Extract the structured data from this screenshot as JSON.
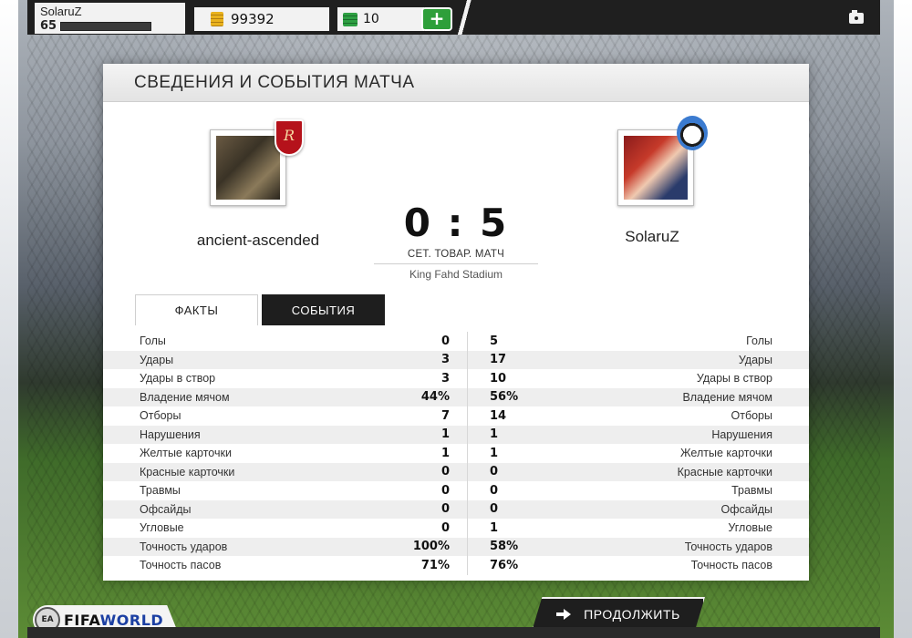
{
  "topbar": {
    "username": "SolaruZ",
    "level": "65",
    "coins": "99392",
    "points": "10",
    "plus_label": "+"
  },
  "panel": {
    "title": "СВЕДЕНИЯ И СОБЫТИЯ МАТЧА"
  },
  "match": {
    "home_team": "ancient-ascended",
    "away_team": "SolaruZ",
    "score": "0 : 5",
    "match_type": "СЕТ. ТОВАР. МАТЧ",
    "stadium": "King Fahd Stadium"
  },
  "tabs": [
    {
      "label": "ФАКТЫ",
      "active": true
    },
    {
      "label": "СОБЫТИЯ",
      "active": false
    }
  ],
  "stats": [
    {
      "label": "Голы",
      "home": "0",
      "away": "5"
    },
    {
      "label": "Удары",
      "home": "3",
      "away": "17"
    },
    {
      "label": "Удары в створ",
      "home": "3",
      "away": "10"
    },
    {
      "label": "Владение мячом",
      "home": "44%",
      "away": "56%"
    },
    {
      "label": "Отборы",
      "home": "7",
      "away": "14"
    },
    {
      "label": "Нарушения",
      "home": "1",
      "away": "1"
    },
    {
      "label": "Желтые карточки",
      "home": "1",
      "away": "1"
    },
    {
      "label": "Красные карточки",
      "home": "0",
      "away": "0"
    },
    {
      "label": "Травмы",
      "home": "0",
      "away": "0"
    },
    {
      "label": "Офсайды",
      "home": "0",
      "away": "0"
    },
    {
      "label": "Угловые",
      "home": "0",
      "away": "1"
    },
    {
      "label": "Точность ударов",
      "home": "100%",
      "away": "58%"
    },
    {
      "label": "Точность пасов",
      "home": "71%",
      "away": "76%"
    }
  ],
  "footer": {
    "continue_label": "ПРОДОЛЖИТЬ",
    "logo_fifa": "FIFA",
    "logo_world": "WORLD",
    "ea_label": "EA"
  },
  "colors": {
    "accent_green": "#2e9f3a",
    "dark": "#1e1e1e",
    "coin_gold": "#e9b21d"
  }
}
